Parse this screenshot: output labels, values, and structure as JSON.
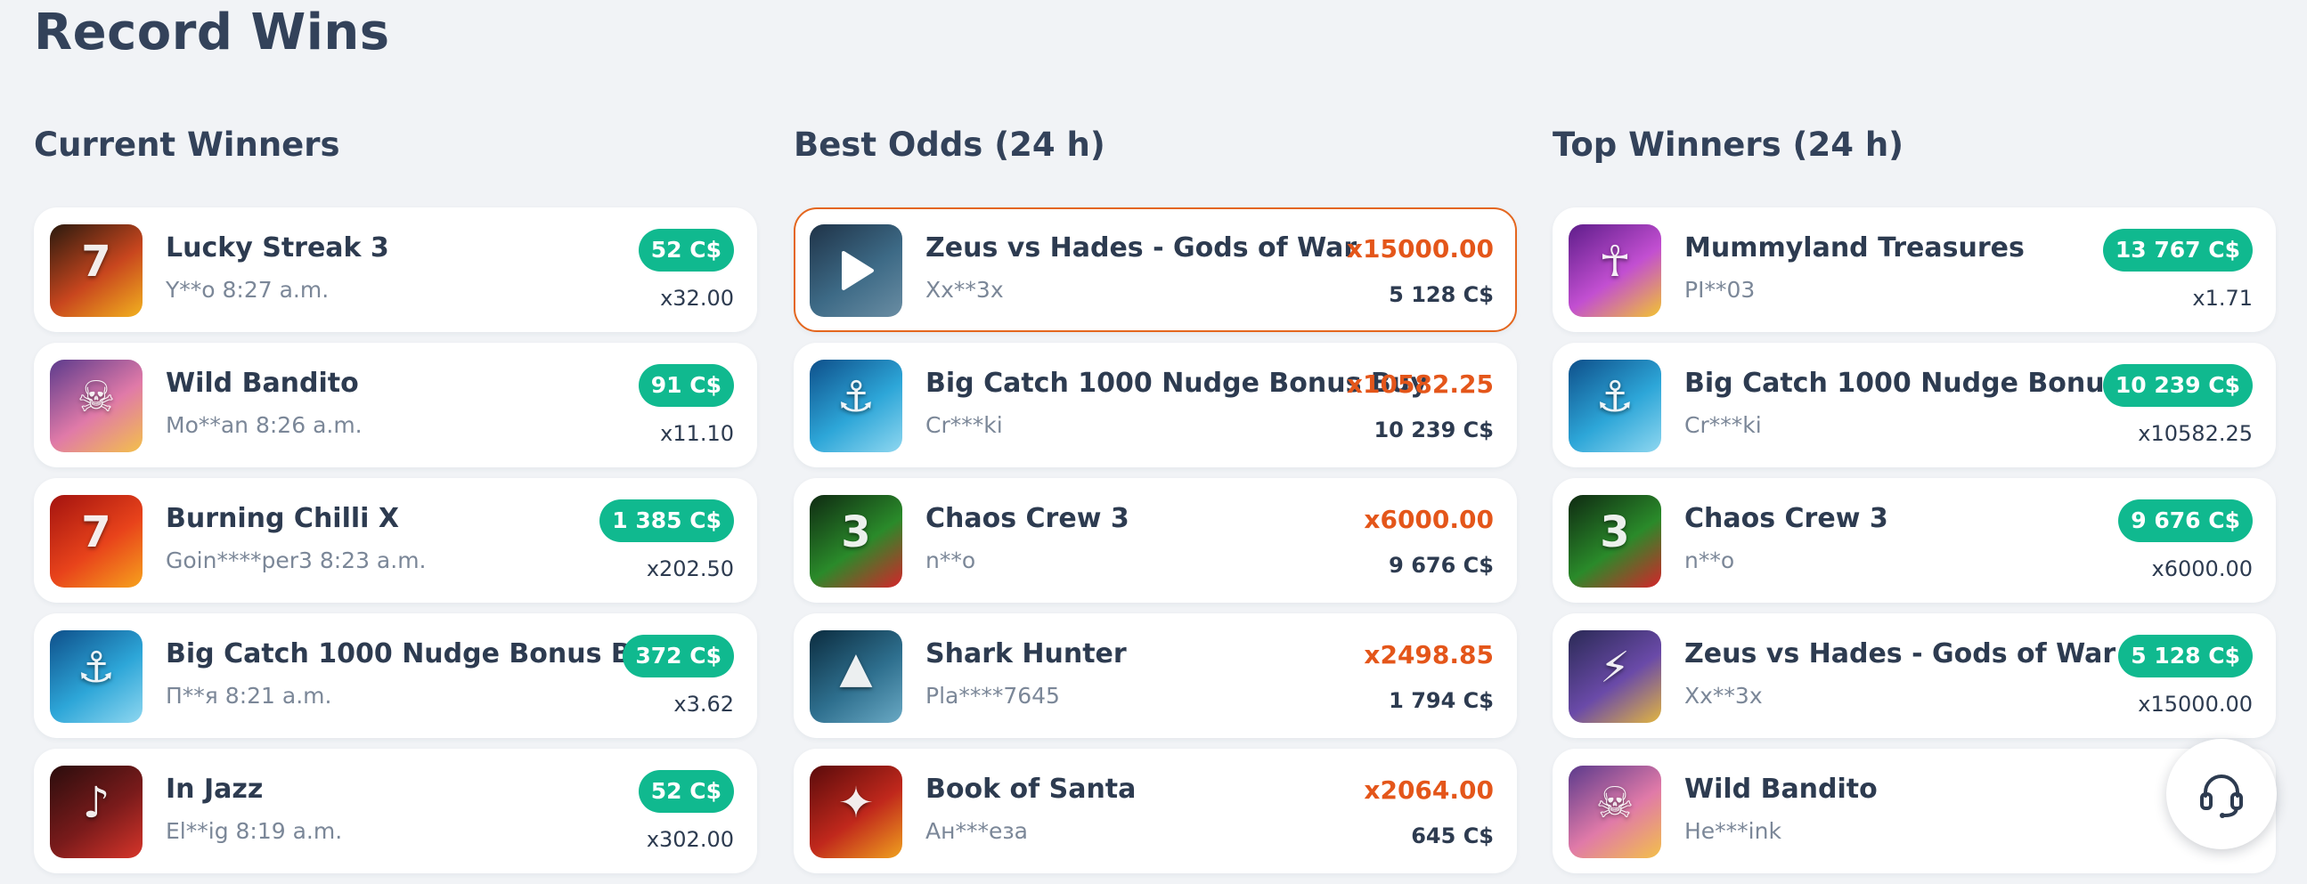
{
  "page": {
    "title": "Record Wins"
  },
  "columns": [
    {
      "title": "Current Winners",
      "type": "current",
      "items": [
        {
          "game": "Lucky Streak 3",
          "sub": "Y**o 8:27 a.m.",
          "amount": "52 C$",
          "multiplier": "x32.00",
          "icon": "lucky-streak-icon",
          "colors": [
            "#2a1a0e",
            "#c8461e",
            "#f2b21f"
          ],
          "glyph": "7",
          "word": ""
        },
        {
          "game": "Wild Bandito",
          "sub": "Mo**an 8:26 a.m.",
          "amount": "91 C$",
          "multiplier": "x11.10",
          "icon": "wild-bandito-icon",
          "colors": [
            "#5b3a8c",
            "#e07aa8",
            "#f3c04a"
          ],
          "glyph": "☠",
          "word": ""
        },
        {
          "game": "Burning Chilli X",
          "sub": "Goin****per3 8:23 a.m.",
          "amount": "1 385 C$",
          "multiplier": "x202.50",
          "icon": "burning-chilli-icon",
          "colors": [
            "#a3130f",
            "#e8431b",
            "#f7a21c"
          ],
          "glyph": "7",
          "word": ""
        },
        {
          "game": "Big Catch 1000 Nudge Bonus Buy",
          "sub": "П**я 8:21 a.m.",
          "amount": "372 C$",
          "multiplier": "x3.62",
          "icon": "big-catch-icon",
          "colors": [
            "#0e4f8a",
            "#2da6d8",
            "#8fd7f0"
          ],
          "glyph": "⚓",
          "word": ""
        },
        {
          "game": "In Jazz",
          "sub": "El**ig 8:19 a.m.",
          "amount": "52 C$",
          "multiplier": "x302.00",
          "icon": "in-jazz-icon",
          "colors": [
            "#2a0d0d",
            "#7a1b1b",
            "#d7352a"
          ],
          "glyph": "♪",
          "word": ""
        }
      ]
    },
    {
      "title": "Best Odds (24 h)",
      "type": "odds",
      "items": [
        {
          "game": "Zeus vs Hades - Gods of War",
          "sub": "Xx**3x",
          "odds": "x15000.00",
          "amount": "5 128 C$",
          "icon": "zeus-vs-hades-icon",
          "colors": [
            "#1f3348",
            "#3d6a86",
            "#6a8da3"
          ],
          "glyph": "",
          "word": "",
          "highlight": true,
          "play": true
        },
        {
          "game": "Big Catch 1000 Nudge Bonus Buy",
          "sub": "Cr***ki",
          "odds": "x10582.25",
          "amount": "10 239 C$",
          "icon": "big-catch-icon",
          "colors": [
            "#0e4f8a",
            "#2da6d8",
            "#8fd7f0"
          ],
          "glyph": "⚓",
          "word": ""
        },
        {
          "game": "Chaos Crew 3",
          "sub": "n**o",
          "odds": "x6000.00",
          "amount": "9 676 C$",
          "icon": "chaos-crew-icon",
          "colors": [
            "#0f2a12",
            "#2a8a2a",
            "#d5242a"
          ],
          "glyph": "3",
          "word": ""
        },
        {
          "game": "Shark Hunter",
          "sub": "Pla****7645",
          "odds": "x2498.85",
          "amount": "1 794 C$",
          "icon": "shark-hunter-icon",
          "colors": [
            "#0b2c3f",
            "#2e6f8e",
            "#6aa9c4"
          ],
          "glyph": "▲",
          "word": ""
        },
        {
          "game": "Book of Santa",
          "sub": "Ан***еза",
          "odds": "x2064.00",
          "amount": "645 C$",
          "icon": "book-of-santa-icon",
          "colors": [
            "#5a0b0b",
            "#c0281c",
            "#f0a11e"
          ],
          "glyph": "✦",
          "word": ""
        }
      ]
    },
    {
      "title": "Top Winners (24 h)",
      "type": "top",
      "items": [
        {
          "game": "Mummyland Treasures",
          "sub": "PI**03",
          "amount": "13 767 C$",
          "multiplier": "x1.71",
          "icon": "mummyland-icon",
          "colors": [
            "#5e1d8a",
            "#c24fd1",
            "#f2c430"
          ],
          "glyph": "☥",
          "word": ""
        },
        {
          "game": "Big Catch 1000 Nudge Bonus Buy",
          "sub": "Cr***ki",
          "amount": "10 239 C$",
          "multiplier": "x10582.25",
          "icon": "big-catch-icon",
          "colors": [
            "#0e4f8a",
            "#2da6d8",
            "#8fd7f0"
          ],
          "glyph": "⚓",
          "word": ""
        },
        {
          "game": "Chaos Crew 3",
          "sub": "n**o",
          "amount": "9 676 C$",
          "multiplier": "x6000.00",
          "icon": "chaos-crew-icon",
          "colors": [
            "#0f2a12",
            "#2a8a2a",
            "#d5242a"
          ],
          "glyph": "3",
          "word": ""
        },
        {
          "game": "Zeus vs Hades - Gods of War",
          "sub": "Xx**3x",
          "amount": "5 128 C$",
          "multiplier": "x15000.00",
          "icon": "zeus-vs-hades-icon",
          "colors": [
            "#2a2a55",
            "#6a4aa8",
            "#e2b640"
          ],
          "glyph": "⚡",
          "word": ""
        },
        {
          "game": "Wild Bandito",
          "sub": "He***ink",
          "amount": "",
          "multiplier": "",
          "icon": "wild-bandito-icon",
          "colors": [
            "#5b3a8c",
            "#e07aa8",
            "#f3c04a"
          ],
          "glyph": "☠",
          "word": "",
          "partial_pill": true
        }
      ]
    }
  ],
  "support": {
    "icon": "headset-icon"
  }
}
